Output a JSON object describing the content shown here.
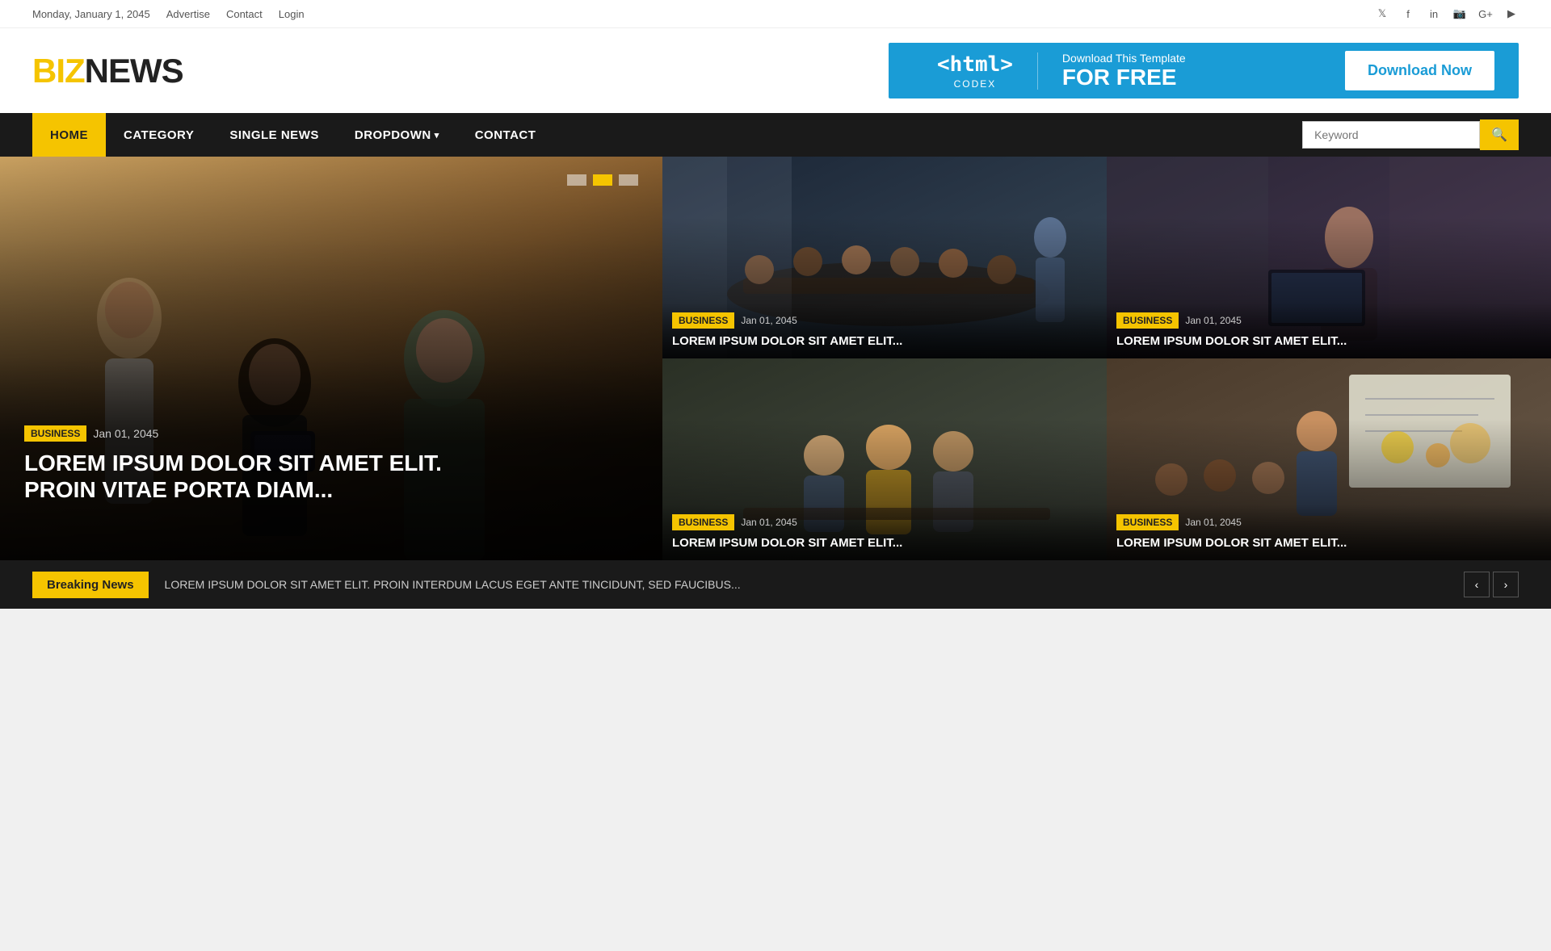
{
  "topbar": {
    "date": "Monday, January 1, 2045",
    "links": [
      "Advertise",
      "Contact",
      "Login"
    ],
    "socials": [
      "twitter",
      "facebook",
      "linkedin",
      "instagram",
      "google-plus",
      "youtube"
    ]
  },
  "logo": {
    "biz": "BIZ",
    "news": "NEWS"
  },
  "banner": {
    "html_tag": "<html>",
    "codex": "CODEX",
    "small_text": "Download This Template",
    "big_text": "FOR FREE",
    "button_label": "Download Now"
  },
  "nav": {
    "items": [
      {
        "label": "HOME",
        "active": true
      },
      {
        "label": "CATEGORY",
        "active": false
      },
      {
        "label": "SINGLE NEWS",
        "active": false
      },
      {
        "label": "DROPDOWN",
        "active": false,
        "has_dropdown": true
      },
      {
        "label": "CONTACT",
        "active": false
      }
    ],
    "search_placeholder": "Keyword"
  },
  "hero": {
    "dots": [
      false,
      true,
      false
    ],
    "tag": "BUSINESS",
    "date": "Jan 01, 2045",
    "title": "LOREM IPSUM DOLOR SIT AMET ELIT.\nPROIN VITAE PORTA DIAM..."
  },
  "articles": [
    {
      "tag": "BUSINESS",
      "date": "Jan 01, 2045",
      "title": "LOREM IPSUM DOLOR SIT AMET ELIT..."
    },
    {
      "tag": "BUSINESS",
      "date": "Jan 01, 2045",
      "title": "LOREM IPSUM DOLOR SIT AMET ELIT..."
    },
    {
      "tag": "BUSINESS",
      "date": "Jan 01, 2045",
      "title": "LOREM IPSUM DOLOR SIT AMET ELIT..."
    },
    {
      "tag": "BUSINESS",
      "date": "Jan 01, 2045",
      "title": "LOREM IPSUM DOLOR SIT AMET ELIT..."
    }
  ],
  "breaking_news": {
    "label": "Breaking News",
    "text": "LOREM IPSUM DOLOR SIT AMET ELIT. PROIN INTERDUM LACUS EGET ANTE TINCIDUNT, SED FAUCIBUS...",
    "prev": "‹",
    "next": "›"
  }
}
